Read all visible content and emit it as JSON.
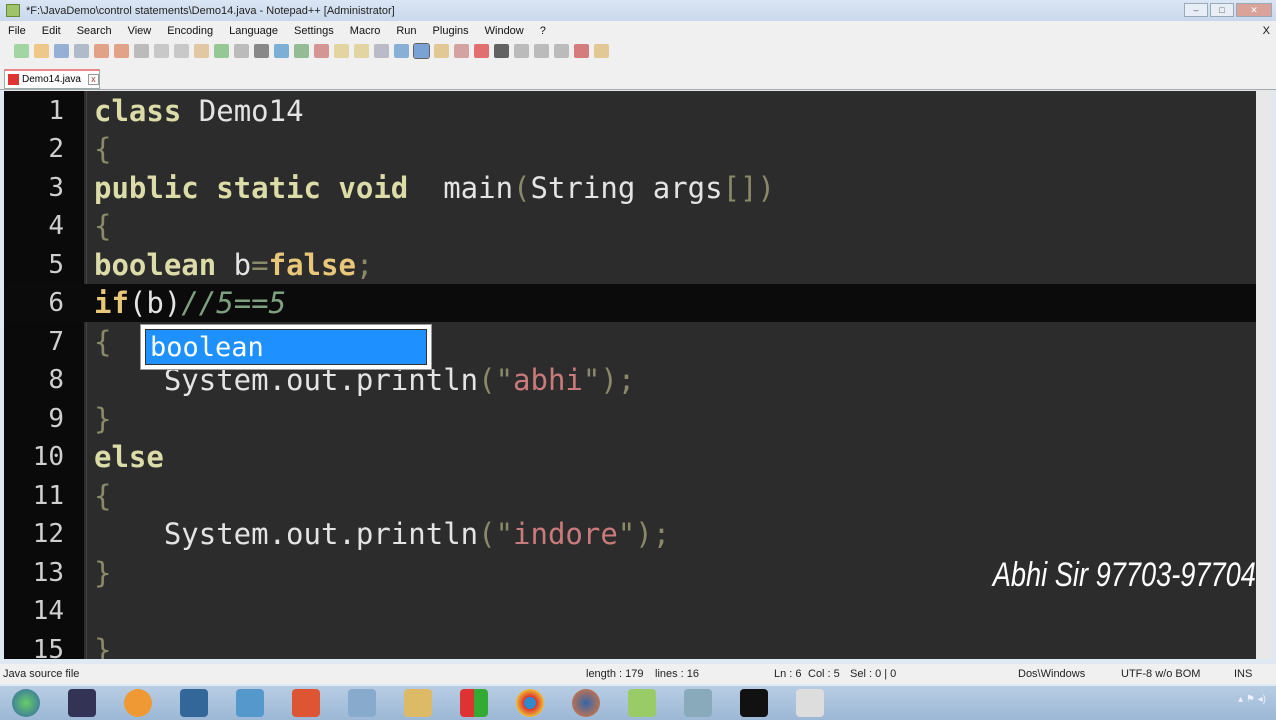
{
  "window": {
    "title": "*F:\\JavaDemo\\control statements\\Demo14.java - Notepad++ [Administrator]",
    "min": "–",
    "max": "□",
    "close": "✕"
  },
  "menu": [
    "File",
    "Edit",
    "Search",
    "View",
    "Encoding",
    "Language",
    "Settings",
    "Macro",
    "Run",
    "Plugins",
    "Window",
    "?"
  ],
  "menu_close": "X",
  "tab": {
    "label": "Demo14.java",
    "close": "x"
  },
  "editor": {
    "line_numbers": [
      "1",
      "2",
      "3",
      "4",
      "5",
      "6",
      "7",
      "8",
      "9",
      "10",
      "11",
      "12",
      "13",
      "14",
      "15"
    ],
    "l1a": "class",
    "l1b": " Demo14",
    "l2": "{",
    "l3a": "public static void",
    "l3b": "  main",
    "l3c": "(",
    "l3d": "String args",
    "l3e": "[])",
    "l4": "{",
    "l5a": "boolean",
    "l5b": " b",
    "l5c": "=",
    "l5d": "false",
    "l5e": ";",
    "l6a": "if",
    "l6b": "(",
    "l6c": "b",
    "l6d": ")",
    "l6e": "//5==5",
    "l7": "{",
    "l8a": "    System.out.println",
    "l8b": "(\"",
    "l8c": "abhi",
    "l8d": "\");",
    "l9": "}",
    "l10": "else",
    "l11": "{",
    "l12a": "    System.out.println",
    "l12b": "(\"",
    "l12c": "indore",
    "l12d": "\");",
    "l13": "}",
    "l14": "",
    "l15": "}"
  },
  "autocomplete": {
    "item": "boolean"
  },
  "watermark": "Abhi Sir 97703-97704",
  "status": {
    "filetype": "Java source file",
    "length": "length : 179",
    "lines": "lines : 16",
    "ln": "Ln : 6",
    "col": "Col : 5",
    "sel": "Sel : 0 | 0",
    "eol": "Dos\\Windows",
    "encoding": "UTF-8 w/o BOM",
    "mode": "INS"
  }
}
